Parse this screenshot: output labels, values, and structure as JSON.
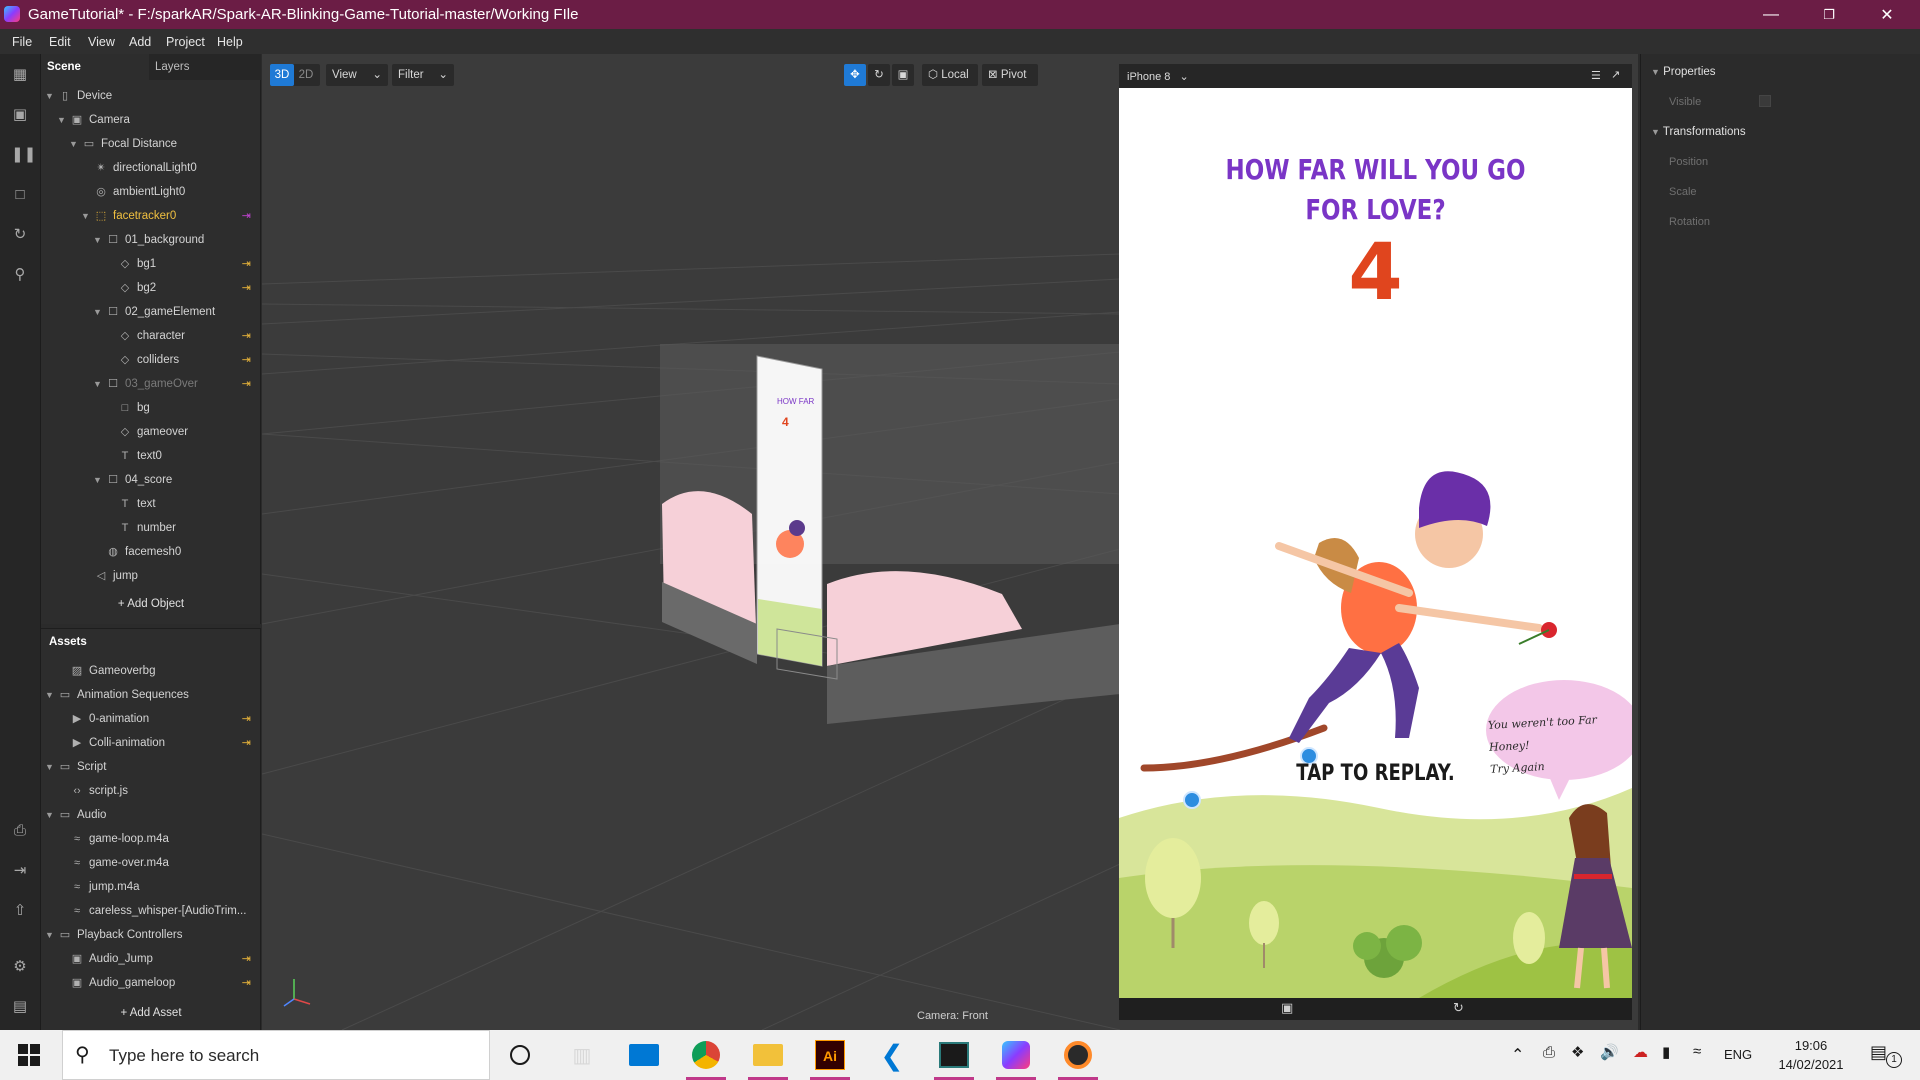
{
  "window": {
    "title": "GameTutorial* - F:/sparkAR/Spark-AR-Blinking-Game-Tutorial-master/Working FIle"
  },
  "menu": [
    "File",
    "Edit",
    "View",
    "Add",
    "Project",
    "Help"
  ],
  "scene": {
    "tabs": [
      "Scene",
      "Layers"
    ],
    "tree": [
      {
        "label": "Device",
        "icon": "device-icon",
        "depth": 0,
        "expand": "open"
      },
      {
        "label": "Camera",
        "icon": "camera-icon",
        "depth": 1,
        "expand": "open"
      },
      {
        "label": "Focal Distance",
        "icon": "focal-distance-icon",
        "depth": 2,
        "expand": "open"
      },
      {
        "label": "directionalLight0",
        "icon": "directional-light-icon",
        "depth": 3
      },
      {
        "label": "ambientLight0",
        "icon": "ambient-light-icon",
        "depth": 3
      },
      {
        "label": "facetracker0",
        "icon": "facetracker-icon",
        "depth": 3,
        "expand": "open",
        "highlight": true,
        "link": "magenta"
      },
      {
        "label": "01_background",
        "icon": "null-object-icon",
        "depth": 4,
        "expand": "open"
      },
      {
        "label": "bg1",
        "icon": "plane-icon",
        "depth": 5,
        "link": "orange"
      },
      {
        "label": "bg2",
        "icon": "plane-icon",
        "depth": 5,
        "link": "orange"
      },
      {
        "label": "02_gameElement",
        "icon": "null-object-icon",
        "depth": 4,
        "expand": "open"
      },
      {
        "label": "character",
        "icon": "plane-icon",
        "depth": 5,
        "link": "orange"
      },
      {
        "label": "colliders",
        "icon": "plane-icon",
        "depth": 5,
        "link": "orange"
      },
      {
        "label": "03_gameOver",
        "icon": "null-object-icon",
        "depth": 4,
        "expand": "open",
        "dim": true,
        "link": "orange"
      },
      {
        "label": "bg",
        "icon": "rectangle-icon",
        "depth": 5
      },
      {
        "label": "gameover",
        "icon": "plane-icon",
        "depth": 5
      },
      {
        "label": "text0",
        "icon": "text-icon",
        "depth": 5
      },
      {
        "label": "04_score",
        "icon": "null-object-icon",
        "depth": 4,
        "expand": "open"
      },
      {
        "label": "text",
        "icon": "text-icon",
        "depth": 5
      },
      {
        "label": "number",
        "icon": "text-icon",
        "depth": 5
      },
      {
        "label": "facemesh0",
        "icon": "facemesh-icon",
        "depth": 4
      },
      {
        "label": "jump",
        "icon": "speaker-icon",
        "depth": 3
      }
    ],
    "add_object": "Add Object"
  },
  "assets": {
    "title": "Assets",
    "tree": [
      {
        "label": "Gameoverbg",
        "icon": "texture-icon",
        "depth": 1
      },
      {
        "label": "Animation Sequences",
        "icon": "folder-icon",
        "depth": 0,
        "expand": "open"
      },
      {
        "label": "0-animation",
        "icon": "animation-icon",
        "depth": 1,
        "link": "orange"
      },
      {
        "label": "Colli-animation",
        "icon": "animation-icon",
        "depth": 1,
        "link": "orange"
      },
      {
        "label": "Script",
        "icon": "folder-icon",
        "depth": 0,
        "expand": "open"
      },
      {
        "label": "script.js",
        "icon": "script-icon",
        "depth": 1
      },
      {
        "label": "Audio",
        "icon": "folder-icon",
        "depth": 0,
        "expand": "open"
      },
      {
        "label": "game-loop.m4a",
        "icon": "audio-icon",
        "depth": 1
      },
      {
        "label": "game-over.m4a",
        "icon": "audio-icon",
        "depth": 1
      },
      {
        "label": "jump.m4a",
        "icon": "audio-icon",
        "depth": 1
      },
      {
        "label": "careless_whisper-[AudioTrim...",
        "icon": "audio-icon",
        "depth": 1
      },
      {
        "label": "Playback Controllers",
        "icon": "folder-icon",
        "depth": 0,
        "expand": "open"
      },
      {
        "label": "Audio_Jump",
        "icon": "playback-icon",
        "depth": 1,
        "link": "orange"
      },
      {
        "label": "Audio_gameloop",
        "icon": "playback-icon",
        "depth": 1,
        "link": "orange"
      }
    ],
    "add_asset": "Add Asset"
  },
  "viewport": {
    "mode_3d": "3D",
    "mode_2d": "2D",
    "view_menu": "View",
    "filter_menu": "Filter",
    "local_label": "Local",
    "pivot_label": "Pivot",
    "camera_label": "Camera: Front"
  },
  "simulator": {
    "device": "iPhone 8",
    "heading_line1": "HOW FAR WILL YOU GO",
    "heading_line2": "FOR LOVE?",
    "score": "4",
    "replay_text": "TAP TO REPLAY.",
    "bubble_line1": "You weren't too Far Honey!",
    "bubble_line2": "Try Again",
    "heading_color": "#7a35c6",
    "score_color": "#e0451e"
  },
  "properties": {
    "title": "Properties",
    "visible_label": "Visible",
    "transformations_title": "Transformations",
    "rows": [
      "Position",
      "Scale",
      "Rotation"
    ]
  },
  "taskbar": {
    "search_placeholder": "Type here to search",
    "language": "ENG",
    "time": "19:06",
    "date": "14/02/2021",
    "notification_count": "1"
  }
}
